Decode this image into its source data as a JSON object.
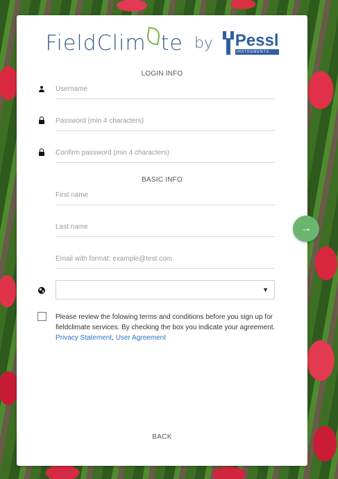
{
  "logo": {
    "brand_part1": "FieldClim",
    "brand_part2": "te",
    "by": "by",
    "partner_name": "Pessl",
    "partner_sub": "INSTRUMENTS"
  },
  "sections": {
    "login_info": "LOGIN INFO",
    "basic_info": "BASIC INFO"
  },
  "fields": {
    "username_placeholder": "Username",
    "password_placeholder": "Password (min 4 characters)",
    "confirm_password_placeholder": "Confirm password (min 4 characters)",
    "first_name_placeholder": "First name",
    "last_name_placeholder": "Last name",
    "email_placeholder": "Email with format: example@test.com"
  },
  "country_select": {
    "selected": "",
    "caret": "▼"
  },
  "terms": {
    "text": "Please review the folowing terms and conditions before you sign up for fieldclimate services. By checking the box you indicate your agreement.",
    "privacy_link": "Privacy Statement",
    "separator": ",",
    "user_agreement_link": "User Agreement",
    "checked": false
  },
  "back_label": "BACK",
  "next_icon": "→",
  "colors": {
    "brand_blue": "#3c5c8a",
    "pessl_blue": "#2f5fa0",
    "leaf_green": "#7fb14a",
    "link": "#2a72c9",
    "next_button": "#6ab66e"
  }
}
